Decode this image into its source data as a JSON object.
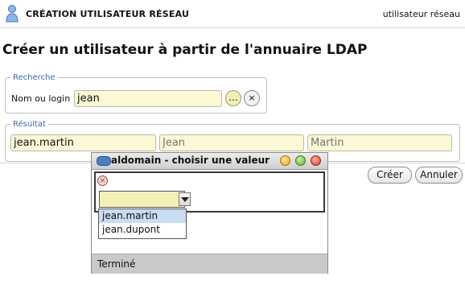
{
  "header": {
    "title": "CRÉATION UTILISATEUR RÉSEAU",
    "right_label": "utilisateur réseau"
  },
  "page": {
    "title": "Créer un utilisateur à partir de l'annuaire LDAP"
  },
  "search": {
    "legend": "Recherche",
    "label": "Nom ou login :",
    "value": "jean",
    "more_label": "…",
    "clear_label": "×"
  },
  "result": {
    "legend": "Résultat",
    "login": "jean.martin",
    "firstname_placeholder": "Jean",
    "lastname_placeholder": "Martin"
  },
  "actions": {
    "create_label": "Créer",
    "cancel_label": "Annuler"
  },
  "dialog": {
    "title": "aldomain - choisir une valeur",
    "error_icon": "×",
    "options": [
      "jean.martin",
      "jean.dupont"
    ],
    "selected_value": "",
    "status": "Terminé"
  },
  "icons": {
    "header": "user-icon",
    "dialog_menu": "window-menu-icon",
    "error": "error-icon"
  },
  "colors": {
    "field_bg": "#fbf8d6",
    "legend_text": "#3a6aa8",
    "selected_option": "#c8dcf2"
  }
}
